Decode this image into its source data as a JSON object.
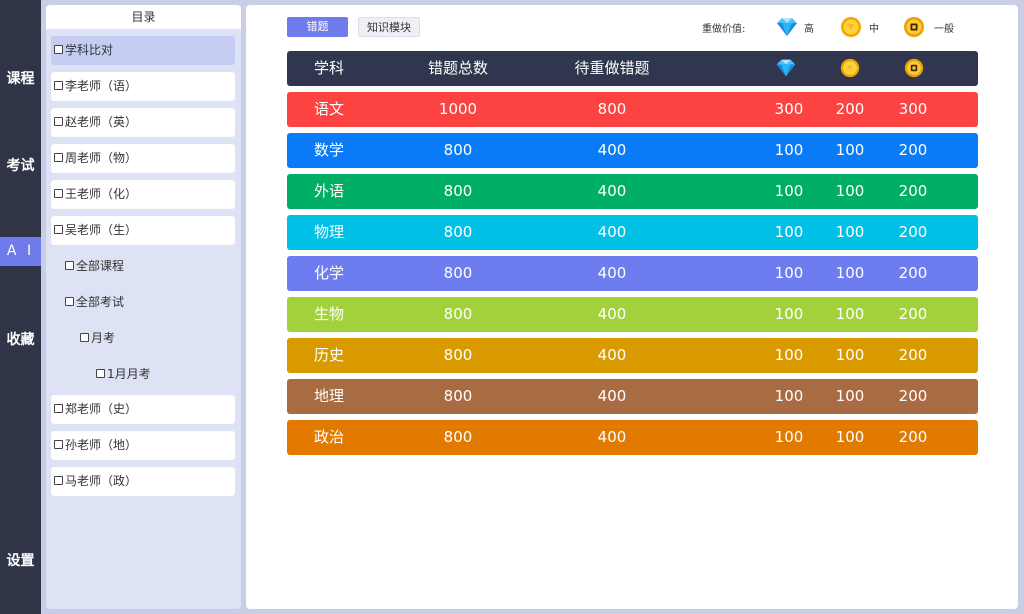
{
  "nav": {
    "items": [
      {
        "label": "课程"
      },
      {
        "label": "考试"
      },
      {
        "label": "A I"
      },
      {
        "label": "收藏"
      },
      {
        "label": "设置"
      }
    ]
  },
  "sidebar": {
    "title": "目录",
    "items": [
      {
        "label": "学科比对"
      },
      {
        "label": "李老师（语）"
      },
      {
        "label": "赵老师（英）"
      },
      {
        "label": "周老师（物）"
      },
      {
        "label": "王老师（化）"
      },
      {
        "label": "吴老师（生）"
      },
      {
        "label": "全部课程"
      },
      {
        "label": "全部考试"
      },
      {
        "label": "月考"
      },
      {
        "label": "1月月考"
      },
      {
        "label": "郑老师（史）"
      },
      {
        "label": "孙老师（地）"
      },
      {
        "label": "马老师（政）"
      }
    ]
  },
  "tabs": [
    {
      "label": "错题"
    },
    {
      "label": "知识模块"
    }
  ],
  "legend": {
    "label": "重做价值:",
    "high": "高",
    "mid": "中",
    "low": "一般",
    "icons": [
      "diamond-icon",
      "gold-coin-icon",
      "copper-coin-icon"
    ]
  },
  "table": {
    "headers": {
      "subject": "学科",
      "total": "错题总数",
      "redo": "待重做错题"
    },
    "rows": [
      {
        "subject": "语文",
        "total": "1000",
        "redo": "800",
        "high": "300",
        "mid": "200",
        "low": "300",
        "color": "#fd4242"
      },
      {
        "subject": "数学",
        "total": "800",
        "redo": "400",
        "high": "100",
        "mid": "100",
        "low": "200",
        "color": "#0a7bf7"
      },
      {
        "subject": "外语",
        "total": "800",
        "redo": "400",
        "high": "100",
        "mid": "100",
        "low": "200",
        "color": "#00ae66"
      },
      {
        "subject": "物理",
        "total": "800",
        "redo": "400",
        "high": "100",
        "mid": "100",
        "low": "200",
        "color": "#00c0e6"
      },
      {
        "subject": "化学",
        "total": "800",
        "redo": "400",
        "high": "100",
        "mid": "100",
        "low": "200",
        "color": "#6d7cef"
      },
      {
        "subject": "生物",
        "total": "800",
        "redo": "400",
        "high": "100",
        "mid": "100",
        "low": "200",
        "color": "#a3d13c"
      },
      {
        "subject": "历史",
        "total": "800",
        "redo": "400",
        "high": "100",
        "mid": "100",
        "low": "200",
        "color": "#d99a00"
      },
      {
        "subject": "地理",
        "total": "800",
        "redo": "400",
        "high": "100",
        "mid": "100",
        "low": "200",
        "color": "#a86b42"
      },
      {
        "subject": "政治",
        "total": "800",
        "redo": "400",
        "high": "100",
        "mid": "100",
        "low": "200",
        "color": "#e27a00"
      }
    ]
  },
  "colors": {
    "nav_bg": "#2f3447",
    "accent": "#6f7bea",
    "header_bg": "#30364d",
    "sidebar_bg": "#dde2f4"
  }
}
